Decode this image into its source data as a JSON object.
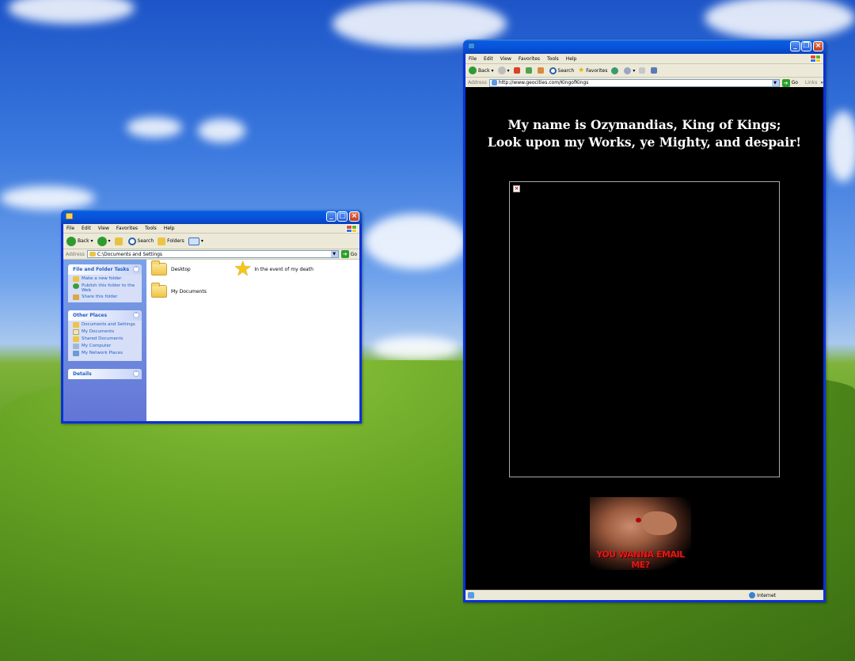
{
  "desktop": {
    "wallpaper": "bliss"
  },
  "explorer": {
    "menu": [
      "File",
      "Edit",
      "View",
      "Favorites",
      "Tools",
      "Help"
    ],
    "toolbar": {
      "back": "Back",
      "search": "Search",
      "folders": "Folders"
    },
    "address": {
      "label": "Address",
      "value": "C:\\Documents and Settings",
      "go": "Go"
    },
    "tasks": {
      "title": "File and Folder Tasks",
      "items": [
        "Make a new folder",
        "Publish this folder to the Web",
        "Share this folder"
      ]
    },
    "places": {
      "title": "Other Places",
      "items": [
        "Documents and Settings",
        "My Documents",
        "Shared Documents",
        "My Computer",
        "My Network Places"
      ]
    },
    "details": {
      "title": "Details"
    },
    "files": [
      {
        "name": "Desktop",
        "icon": "folder-icon"
      },
      {
        "name": "In the event of my death",
        "icon": "star-icon"
      },
      {
        "name": "My Documents",
        "icon": "folder-icon"
      }
    ]
  },
  "browser": {
    "menu": [
      "File",
      "Edit",
      "View",
      "Favorites",
      "Tools",
      "Help"
    ],
    "toolbar": {
      "back": "Back",
      "search": "Search",
      "favorites": "Favorites"
    },
    "address": {
      "label": "Address",
      "value": "http://www.geocities.com/KingofKings",
      "go": "Go",
      "links": "Links"
    },
    "page": {
      "line1": "My name is Ozymandias, King of Kings;",
      "line2": "Look upon my Works, ye Mighty, and despair!",
      "gif_caption": "YOU WANNA EMAIL ME?"
    },
    "status": {
      "zone": "Internet"
    }
  },
  "colors": {
    "titlebar": "#0a5bdb",
    "close": "#c33d1b",
    "taskpane": "#6f8ee0",
    "page_bg": "#000000"
  }
}
